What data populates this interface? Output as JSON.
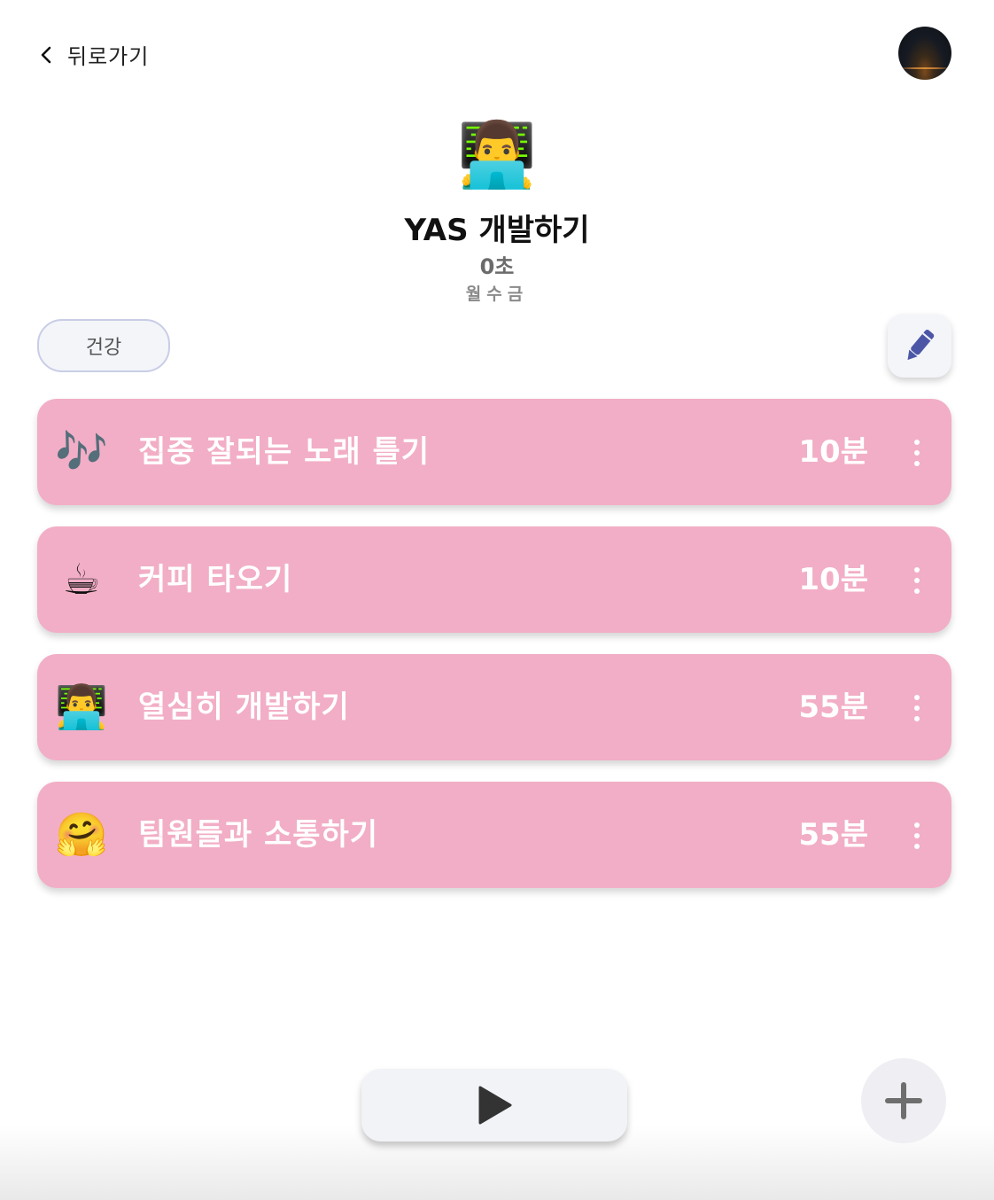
{
  "header": {
    "back_label": "뒤로가기",
    "back_icon": "chevron-left-icon",
    "avatar_icon": "night-sky-avatar"
  },
  "routine": {
    "icon": "👨‍💻",
    "title": "YAS 개발하기",
    "total_time": "0초",
    "days": "월수금"
  },
  "category": {
    "label": "건강"
  },
  "edit": {
    "icon": "pencil-icon",
    "color": "#4b57a6"
  },
  "tasks": [
    {
      "emoji": "🎶",
      "name": "집중 잘되는 노래 틀기",
      "duration": "10분"
    },
    {
      "emoji": "☕",
      "name": "커피 타오기",
      "duration": "10분"
    },
    {
      "emoji": "👨‍💻",
      "name": "열심히 개발하기",
      "duration": "55분"
    },
    {
      "emoji": "🤗",
      "name": "팀원들과 소통하기",
      "duration": "55분"
    }
  ],
  "controls": {
    "play_icon": "play-icon",
    "add_icon": "plus-icon"
  },
  "colors": {
    "card_background": "#f2aec6",
    "card_text": "#ffffff",
    "pill_border": "#c9cde6",
    "button_background": "#f2f3f7"
  }
}
